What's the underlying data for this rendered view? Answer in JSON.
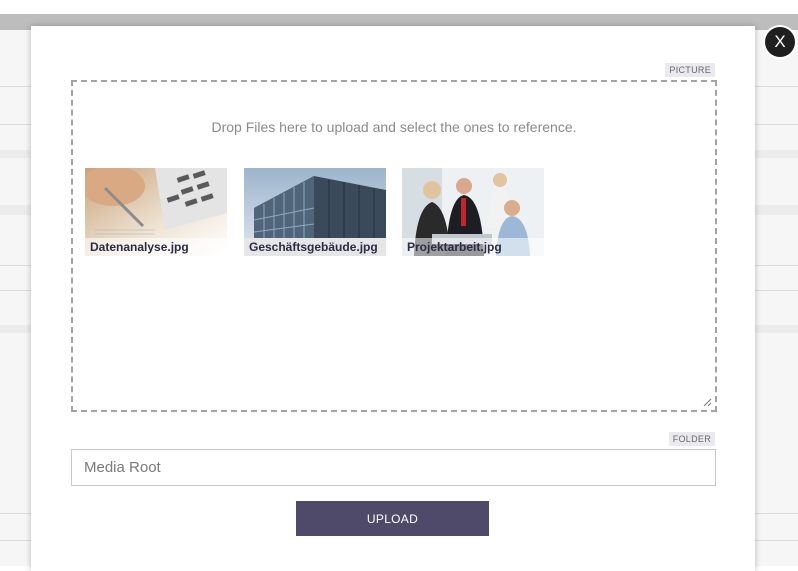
{
  "dialog": {
    "close_label": "X",
    "picture_tag": "PICTURE",
    "drop_hint": "Drop Files here to upload and select the ones to reference.",
    "folder_tag": "FOLDER",
    "folder_value": "Media Root",
    "upload_label": "UPLOAD"
  },
  "files": [
    {
      "name": "Datenanalyse.jpg"
    },
    {
      "name": "Geschäftsgebäude.jpg"
    },
    {
      "name": "Projektarbeit.jpg"
    }
  ],
  "colors": {
    "upload_button": "#4f4a6a",
    "close_button": "#1f1f1f",
    "dropzone_border": "#a3a3a3"
  }
}
